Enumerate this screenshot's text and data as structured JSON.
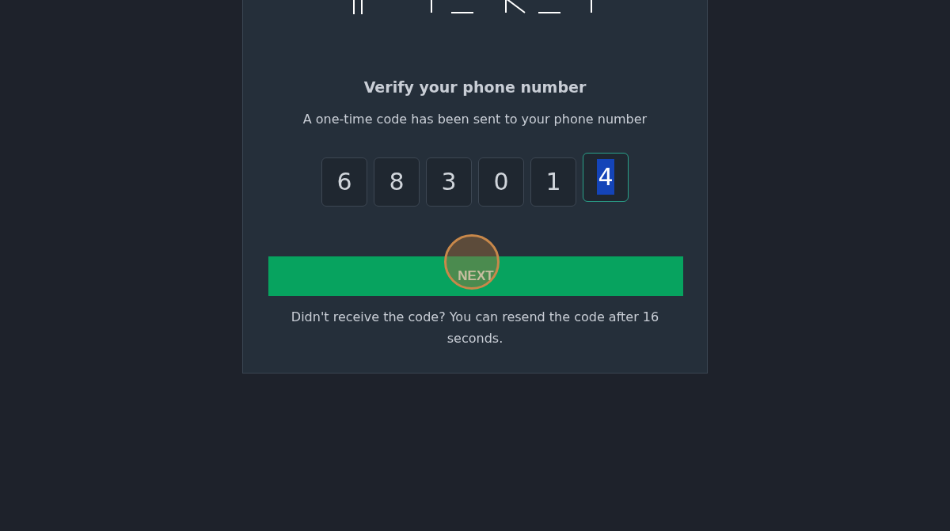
{
  "title": "Verify your phone number",
  "subtitle": "A one-time code has been sent to your phone number",
  "code_digits": [
    {
      "value": "6",
      "selected": false
    },
    {
      "value": "8",
      "selected": false
    },
    {
      "value": "3",
      "selected": false
    },
    {
      "value": "0",
      "selected": false
    },
    {
      "value": "1",
      "selected": false
    },
    {
      "value": "4",
      "selected": true
    }
  ],
  "next_button": "NEXT",
  "resend_note": "Didn't receive the code? You can resend the code after 16 seconds."
}
